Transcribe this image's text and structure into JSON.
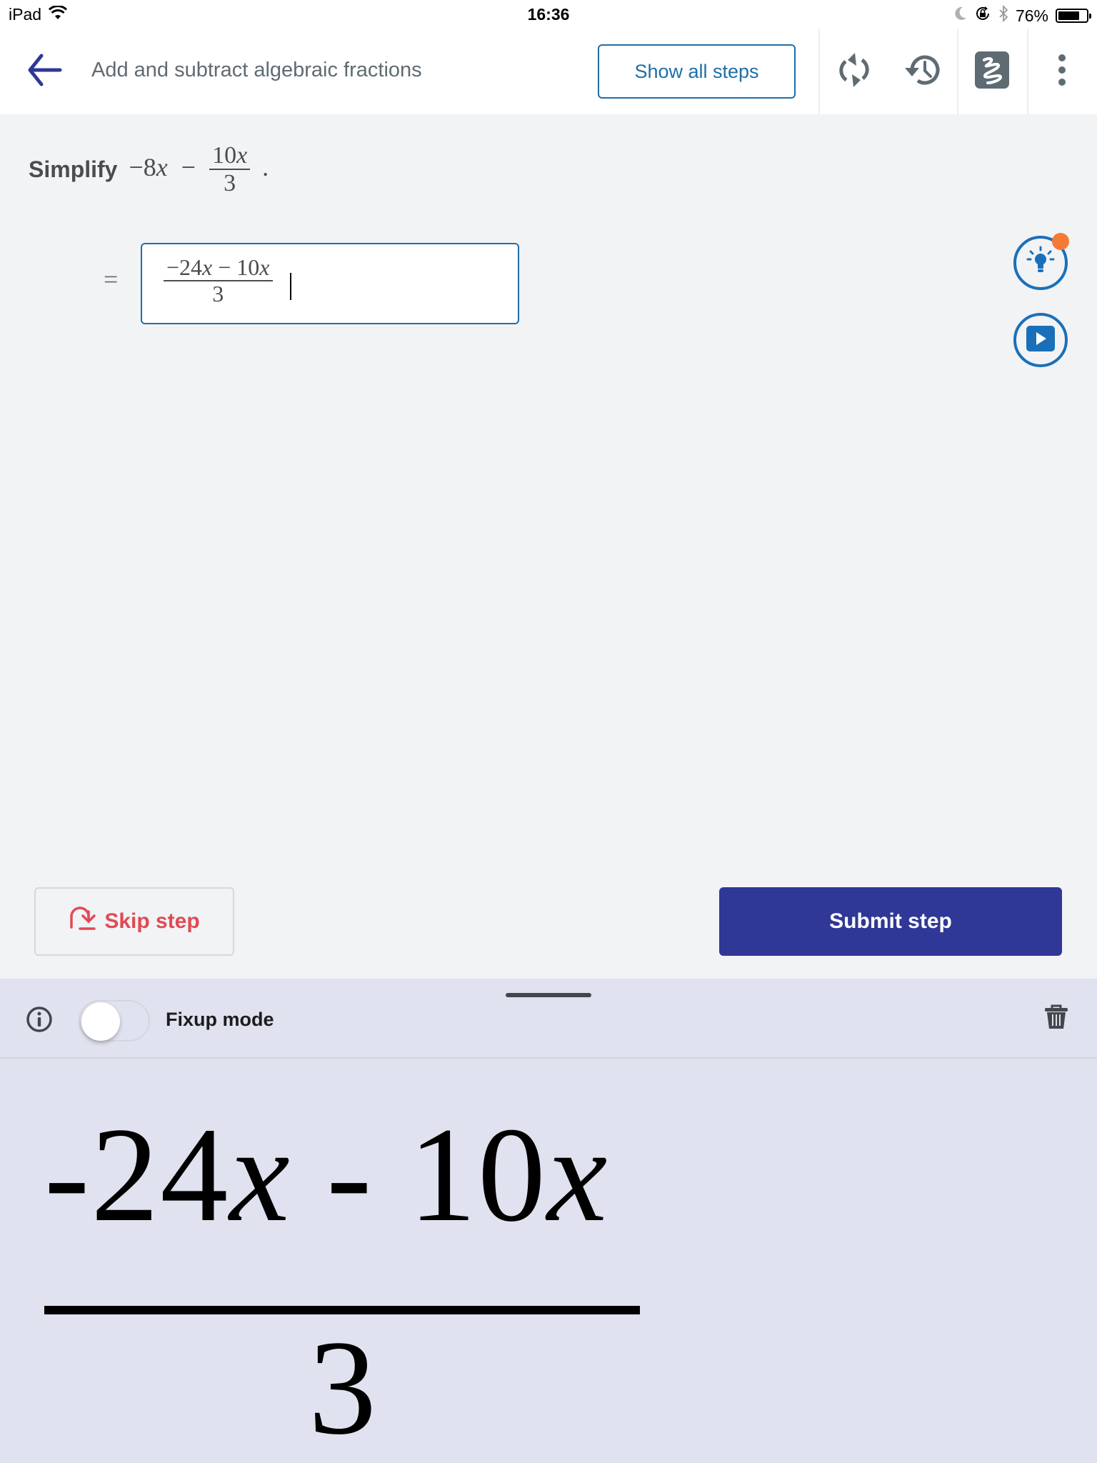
{
  "status_bar": {
    "device": "iPad",
    "time": "16:36",
    "battery_percent_label": "76%",
    "battery_level": 0.76,
    "icons": [
      "wifi-icon",
      "moon-icon",
      "rotation-lock-icon",
      "bluetooth-icon",
      "battery-icon"
    ]
  },
  "header": {
    "title": "Add and subtract algebraic fractions",
    "show_all_steps_label": "Show all steps",
    "icons": [
      "back-arrow-icon",
      "refresh-icon",
      "history-icon",
      "scribble-icon",
      "more-vertical-icon"
    ]
  },
  "problem": {
    "instruction": "Simplify",
    "expression_prefix": "−8",
    "variable": "x",
    "minus": "−",
    "fraction_numerator_coef": "10",
    "fraction_denominator": "3",
    "period": "."
  },
  "answer": {
    "equals": "=",
    "numerator": {
      "part1": "−24",
      "var1": "x",
      "op": " − ",
      "part2": "10",
      "var2": "x"
    },
    "denominator": "3"
  },
  "side_tools": {
    "hint_icon": "lightbulb-icon",
    "video_icon": "play-icon",
    "hint_has_notification": true,
    "accent": "#1a70b8",
    "notification_color": "#f47a35"
  },
  "actions": {
    "skip_label": "Skip step",
    "submit_label": "Submit step",
    "skip_color": "#e04a55",
    "submit_color": "#2f3896"
  },
  "handwriting_panel": {
    "fixup_label": "Fixup mode",
    "fixup_enabled": false,
    "recognized": {
      "numerator": {
        "part1": "-24",
        "var1": "x",
        "op": " - ",
        "part2": "10",
        "var2": "x"
      },
      "denominator": "3"
    }
  }
}
